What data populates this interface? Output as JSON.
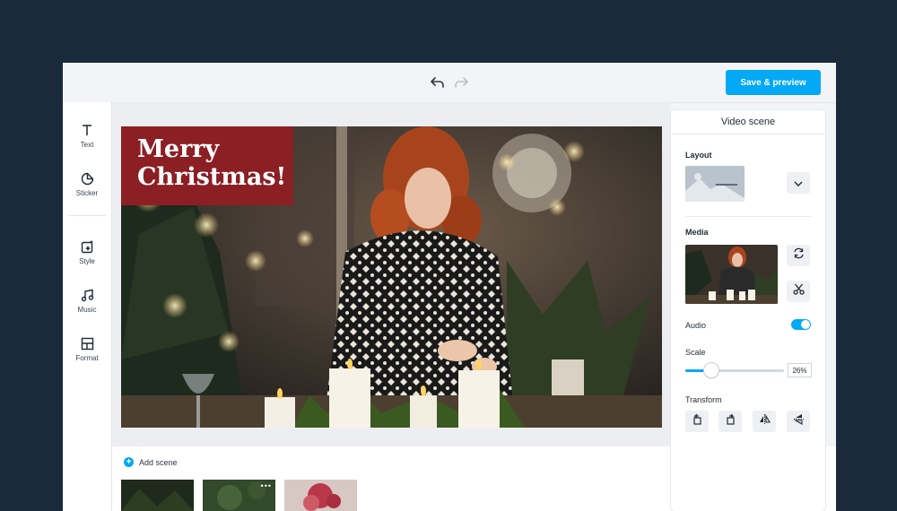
{
  "toolbar": {
    "undo_icon": "undo-icon",
    "redo_icon": "redo-icon",
    "save_label": "Save & preview"
  },
  "sidebar": {
    "items": [
      {
        "label": "Text",
        "icon": "text-icon"
      },
      {
        "label": "Sticker",
        "icon": "sticker-icon"
      },
      {
        "label": "Style",
        "icon": "style-icon"
      },
      {
        "label": "Music",
        "icon": "music-icon"
      },
      {
        "label": "Format",
        "icon": "format-icon"
      }
    ]
  },
  "canvas": {
    "overlay_text": "Merry\nChristmas!"
  },
  "scenes": {
    "add_label": "Add scene",
    "more_glyph": "•••"
  },
  "panel": {
    "title": "Video scene",
    "layout_label": "Layout",
    "media_label": "Media",
    "audio_label": "Audio",
    "audio_on": true,
    "scale_label": "Scale",
    "scale_value": "26%",
    "scale_fraction": 0.26,
    "transform_label": "Transform"
  },
  "colors": {
    "accent": "#03a9f4",
    "frame": "#1b2a3a",
    "overlay": "#8b1f24"
  }
}
